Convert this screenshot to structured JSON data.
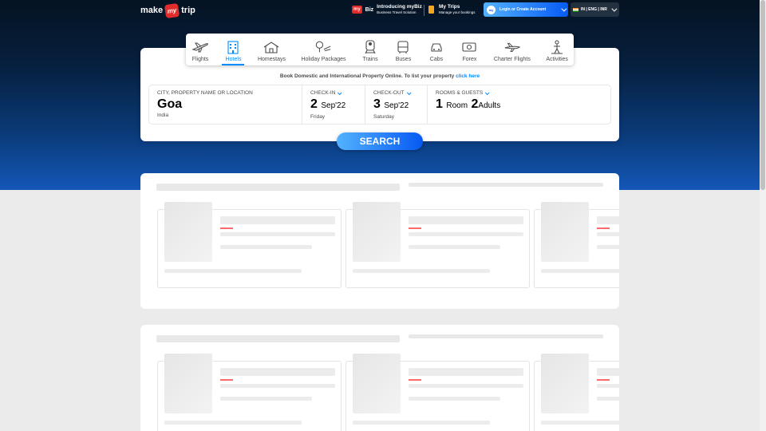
{
  "header": {
    "logo": {
      "word1": "make",
      "badge": "my",
      "word2": "trip"
    },
    "mybiz": {
      "logo": "my",
      "logo_word": "Biz",
      "title": "Introducing myBiz",
      "subtitle": "Business Travel Solution"
    },
    "trips": {
      "title": "My Trips",
      "subtitle": "Manage your bookings"
    },
    "login": {
      "avatar": "my",
      "label": "Login or Create Account"
    },
    "locale": {
      "label": "IN | ENG | INR"
    }
  },
  "nav": {
    "items": [
      {
        "label": "Flights",
        "icon": "flight-icon"
      },
      {
        "label": "Hotels",
        "icon": "hotel-icon",
        "active": true
      },
      {
        "label": "Homestays",
        "icon": "homestay-icon"
      },
      {
        "label": "Holiday Packages",
        "icon": "holiday-package-icon"
      },
      {
        "label": "Trains",
        "icon": "train-icon"
      },
      {
        "label": "Buses",
        "icon": "bus-icon"
      },
      {
        "label": "Cabs",
        "icon": "cab-icon"
      },
      {
        "label": "Forex",
        "icon": "forex-icon"
      },
      {
        "label": "Charter Flights",
        "icon": "charter-flight-icon"
      },
      {
        "label": "Activities",
        "icon": "activities-icon"
      }
    ]
  },
  "search": {
    "info_text": "Book Domestic and International Property Online. To list your property ",
    "info_link": "click here",
    "city": {
      "label": "CITY, PROPERTY NAME OR LOCATION",
      "value": "Goa",
      "sub": "India"
    },
    "checkin": {
      "label": "CHECK-IN",
      "day": "2",
      "month": "Sep'22",
      "weekday": "Friday"
    },
    "checkout": {
      "label": "CHECK-OUT",
      "day": "3",
      "month": "Sep'22",
      "weekday": "Saturday"
    },
    "guests": {
      "label": "ROOMS & GUESTS",
      "rooms": "1",
      "rooms_label": "Room",
      "adults": "2",
      "adults_label": "Adults"
    },
    "button": "SEARCH"
  },
  "colors": {
    "accent": "#008cff",
    "brand_red": "#e22c2c",
    "hero_dark": "#051322",
    "hero_light": "#1457b8"
  }
}
